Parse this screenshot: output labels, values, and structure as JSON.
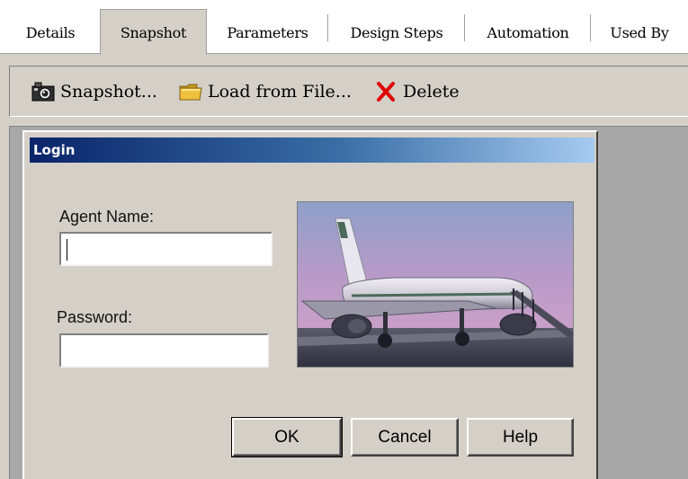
{
  "tabs": [
    {
      "label": "Details"
    },
    {
      "label": "Snapshot"
    },
    {
      "label": "Parameters"
    },
    {
      "label": "Design Steps"
    },
    {
      "label": "Automation"
    },
    {
      "label": "Used By"
    }
  ],
  "active_tab": "Snapshot",
  "toolbar": {
    "snapshot_label": "Snapshot...",
    "load_label": "Load from File...",
    "delete_label": "Delete"
  },
  "dialog": {
    "title": "Login",
    "agent_name_label": "Agent Name:",
    "agent_name_value": "",
    "password_label": "Password:",
    "password_value": "",
    "ok_label": "OK",
    "cancel_label": "Cancel",
    "help_label": "Help"
  },
  "icons": {
    "snapshot": "camera-icon",
    "load": "folder-icon",
    "delete": "red-x-icon",
    "image": "airplane-photo"
  },
  "colors": {
    "title_start": "#0a246a",
    "title_end": "#a6caf0",
    "delete_red": "#e00000",
    "folder_yellow": "#f0c040"
  }
}
